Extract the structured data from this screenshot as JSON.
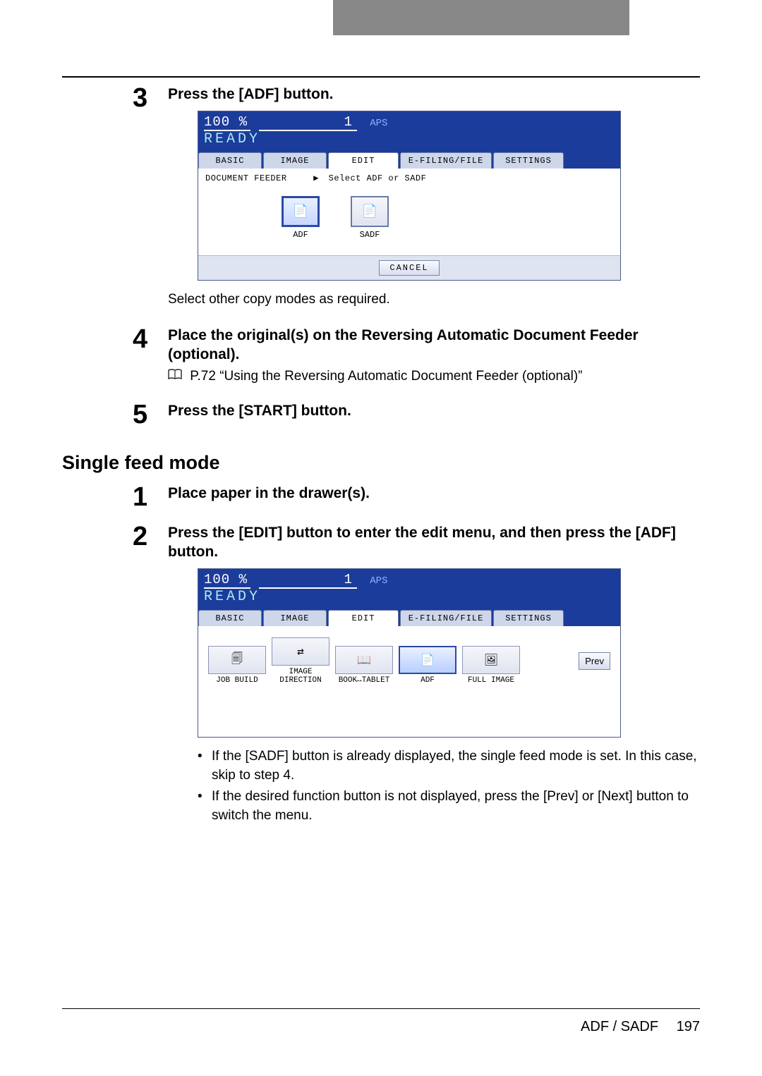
{
  "steps_a": {
    "s3": {
      "num": "3",
      "title": "Press the [ADF] button.",
      "note": "Select other copy modes as required."
    },
    "s4": {
      "num": "4",
      "title": "Place the original(s) on the Reversing Automatic Document Feeder (optional).",
      "ref": "P.72 “Using the Reversing Automatic Document Feeder (optional)”"
    },
    "s5": {
      "num": "5",
      "title": "Press the [START] button."
    }
  },
  "section_b": {
    "heading": "Single feed mode",
    "s1": {
      "num": "1",
      "title": "Place paper in the drawer(s)."
    },
    "s2": {
      "num": "2",
      "title": "Press the [EDIT] button to enter the edit menu, and then press the [ADF] button."
    },
    "bullets": [
      "If the [SADF] button is already displayed, the single feed mode is set. In this case, skip to step 4.",
      "If the desired function button is not displayed, press the [Prev] or [Next] button to switch the menu."
    ]
  },
  "panel1": {
    "percent": "100",
    "percent_unit": "%",
    "count": "1",
    "mode": "APS",
    "status": "READY",
    "tabs": [
      "BASIC",
      "IMAGE",
      "EDIT",
      "E-FILING/FILE",
      "SETTINGS"
    ],
    "active_tab": 2,
    "breadcrumb": "DOCUMENT FEEDER",
    "breadcrumb_hint": "Select ADF or SADF",
    "buttons": [
      {
        "label": "ADF",
        "selected": true
      },
      {
        "label": "SADF",
        "selected": false
      }
    ],
    "cancel": "CANCEL"
  },
  "panel2": {
    "percent": "100",
    "percent_unit": "%",
    "count": "1",
    "mode": "APS",
    "status": "READY",
    "tabs": [
      "BASIC",
      "IMAGE",
      "EDIT",
      "E-FILING/FILE",
      "SETTINGS"
    ],
    "active_tab": 2,
    "buttons": [
      {
        "label": "JOB BUILD"
      },
      {
        "label": "IMAGE DIRECTION"
      },
      {
        "label": "BOOK↔TABLET"
      },
      {
        "label": "ADF",
        "selected": true
      },
      {
        "label": "FULL IMAGE"
      }
    ],
    "prev": "Prev"
  },
  "footer": {
    "section": "ADF / SADF",
    "page": "197"
  }
}
